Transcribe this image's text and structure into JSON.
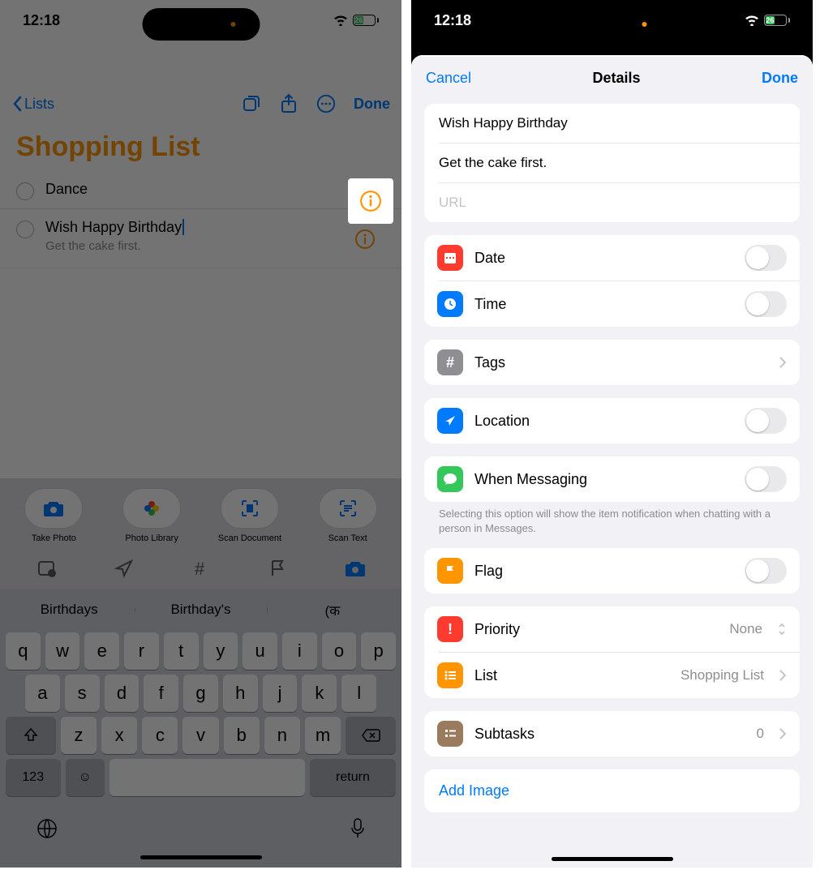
{
  "status": {
    "time": "12:18",
    "battery_text": "26"
  },
  "left": {
    "back": "Lists",
    "done": "Done",
    "title": "Shopping List",
    "reminders": [
      {
        "title": "Dance",
        "subtitle": ""
      },
      {
        "title": "Wish Happy Birthday",
        "subtitle": "Get the cake first."
      }
    ],
    "camera_options": [
      {
        "label": "Take Photo"
      },
      {
        "label": "Photo Library"
      },
      {
        "label": "Scan Document"
      },
      {
        "label": "Scan Text"
      }
    ],
    "suggestions": [
      "Birthdays",
      "Birthday's",
      "(क"
    ]
  },
  "right": {
    "cancel": "Cancel",
    "title": "Details",
    "done": "Done",
    "item_title": "Wish Happy Birthday",
    "item_notes": "Get the cake first.",
    "url_placeholder": "URL",
    "rows": {
      "date": "Date",
      "time": "Time",
      "tags": "Tags",
      "location": "Location",
      "messaging": "When Messaging",
      "messaging_footer": "Selecting this option will show the item notification when chatting with a person in Messages.",
      "flag": "Flag",
      "priority": "Priority",
      "priority_value": "None",
      "list": "List",
      "list_value": "Shopping List",
      "subtasks": "Subtasks",
      "subtasks_value": "0",
      "add_image": "Add Image"
    }
  },
  "keyboard": {
    "row1": [
      "q",
      "w",
      "e",
      "r",
      "t",
      "y",
      "u",
      "i",
      "o",
      "p"
    ],
    "row2": [
      "a",
      "s",
      "d",
      "f",
      "g",
      "h",
      "j",
      "k",
      "l"
    ],
    "row3": [
      "z",
      "x",
      "c",
      "v",
      "b",
      "n",
      "m"
    ],
    "numbers": "123",
    "return": "return"
  }
}
